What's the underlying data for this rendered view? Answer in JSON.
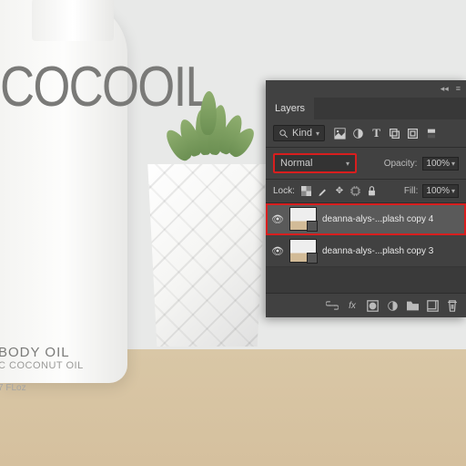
{
  "product": {
    "brand": "COCOOIL",
    "label_line1": "BODY OIL",
    "label_line2": "C COCONUT OIL",
    "label_line3": "7 FLoz"
  },
  "panel": {
    "title": "Layers",
    "filter": {
      "label": "Kind",
      "search_icon": "search-icon"
    },
    "blend": {
      "mode": "Normal",
      "opacity_label": "Opacity:",
      "opacity_value": "100%"
    },
    "lock": {
      "label": "Lock:",
      "fill_label": "Fill:",
      "fill_value": "100%"
    },
    "layers": [
      {
        "name": "deanna-alys-...plash copy 4",
        "visible": true,
        "selected": true
      },
      {
        "name": "deanna-alys-...plash copy 3",
        "visible": true,
        "selected": false
      }
    ],
    "icons": {
      "image": "image-icon",
      "adjust": "adjust-icon",
      "type": "type-icon",
      "shape": "shape-icon",
      "smart": "smart-object-icon",
      "artboard": "artboard-icon",
      "link": "link-icon",
      "fx": "fx",
      "mask": "mask-icon",
      "fill": "fill-circle-icon",
      "group": "folder-icon",
      "new": "new-layer-icon",
      "trash": "trash-icon"
    },
    "highlight_color": "#d81e1e"
  }
}
